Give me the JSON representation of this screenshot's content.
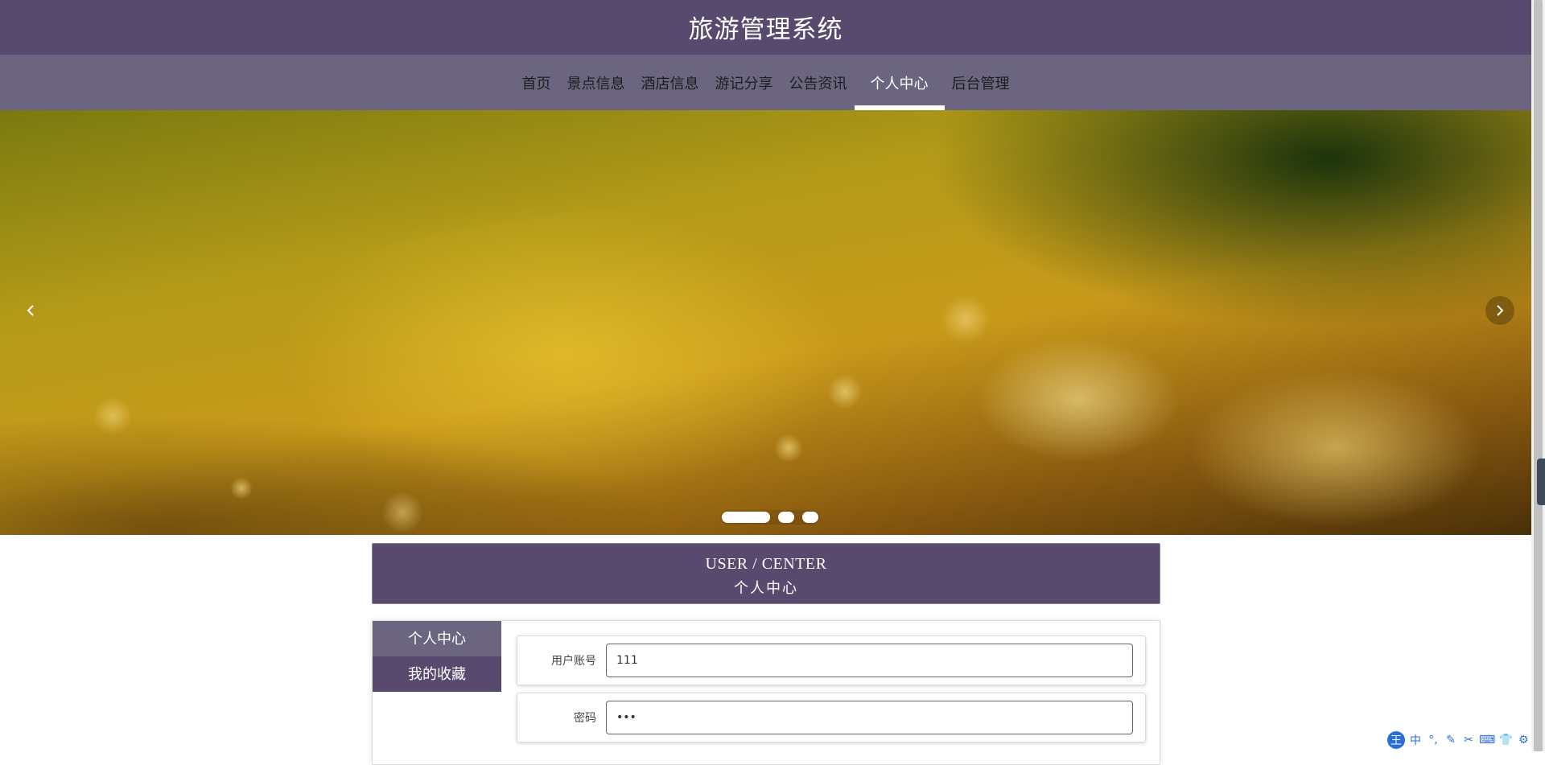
{
  "header": {
    "title": "旅游管理系统"
  },
  "nav": {
    "items": [
      {
        "label": "首页"
      },
      {
        "label": "景点信息"
      },
      {
        "label": "酒店信息"
      },
      {
        "label": "游记分享"
      },
      {
        "label": "公告资讯"
      },
      {
        "label": "个人中心",
        "active": true
      },
      {
        "label": "后台管理"
      }
    ]
  },
  "banner": {
    "arrow_left": "‹",
    "arrow_right": "›",
    "active_slide": 1,
    "slide_count": 3
  },
  "section": {
    "title_en": "USER / CENTER",
    "title_cn": "个人中心"
  },
  "side_menu": {
    "items": [
      {
        "label": "个人中心",
        "active": true
      },
      {
        "label": "我的收藏"
      }
    ]
  },
  "form": {
    "fields": [
      {
        "label": "用户账号",
        "value": "111"
      },
      {
        "label": "密码",
        "value": "•••"
      }
    ]
  },
  "ime": {
    "logo": "王",
    "items": [
      "中",
      "°,",
      "✎",
      "✂",
      "⌨",
      "👕",
      "⚙"
    ]
  },
  "colors": {
    "header_bg": "#584a6e",
    "nav_bg": "#6b6580",
    "accent": "#584a6e"
  }
}
